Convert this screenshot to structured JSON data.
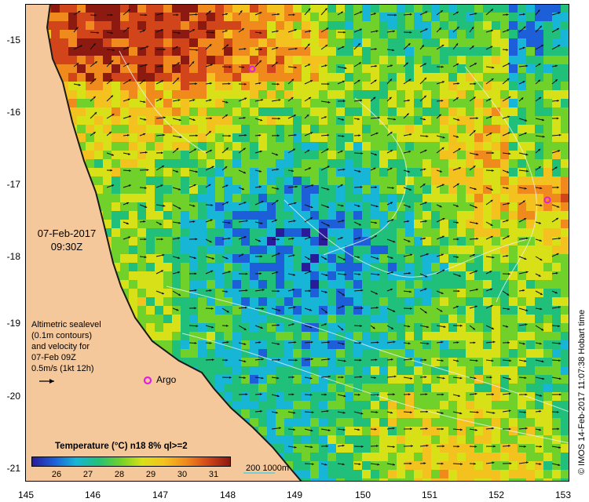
{
  "map": {
    "lon_ticks": [
      "145",
      "146",
      "147",
      "148",
      "149",
      "150",
      "151",
      "152",
      "153"
    ],
    "lat_ticks": [
      "-15",
      "-16",
      "-17",
      "-18",
      "-19",
      "-20",
      "-21"
    ],
    "land_color": "#f5c89c",
    "coast_color": "#1a1a1a",
    "contour_color": "#e8f4f0",
    "arrow_color": "#111111"
  },
  "overlay": {
    "date": "07-Feb-2017",
    "time": "09:30Z",
    "altimetry_lines": [
      "Altimetric sealevel",
      "(0.1m contours)",
      "and velocity for",
      "07-Feb 09Z",
      "0.5m/s (1kt 12h)"
    ],
    "argo_label": "Argo",
    "argo_color": "#e020e0"
  },
  "colorbar": {
    "title": "Temperature (°C) n18 8% ql>=2",
    "labels": [
      "26",
      "27",
      "28",
      "29",
      "30",
      "31"
    ],
    "colors": [
      "#2a1b9a",
      "#1d5fd8",
      "#17b6d6",
      "#21c07a",
      "#6fd12a",
      "#d8e018",
      "#f4c21e",
      "#f08a1c",
      "#d2451a",
      "#8c1a10"
    ]
  },
  "depth_legend": {
    "text": "200  1000m"
  },
  "credit": "© IMOS 14-Feb-2017 11:07:38 Hobart time"
}
